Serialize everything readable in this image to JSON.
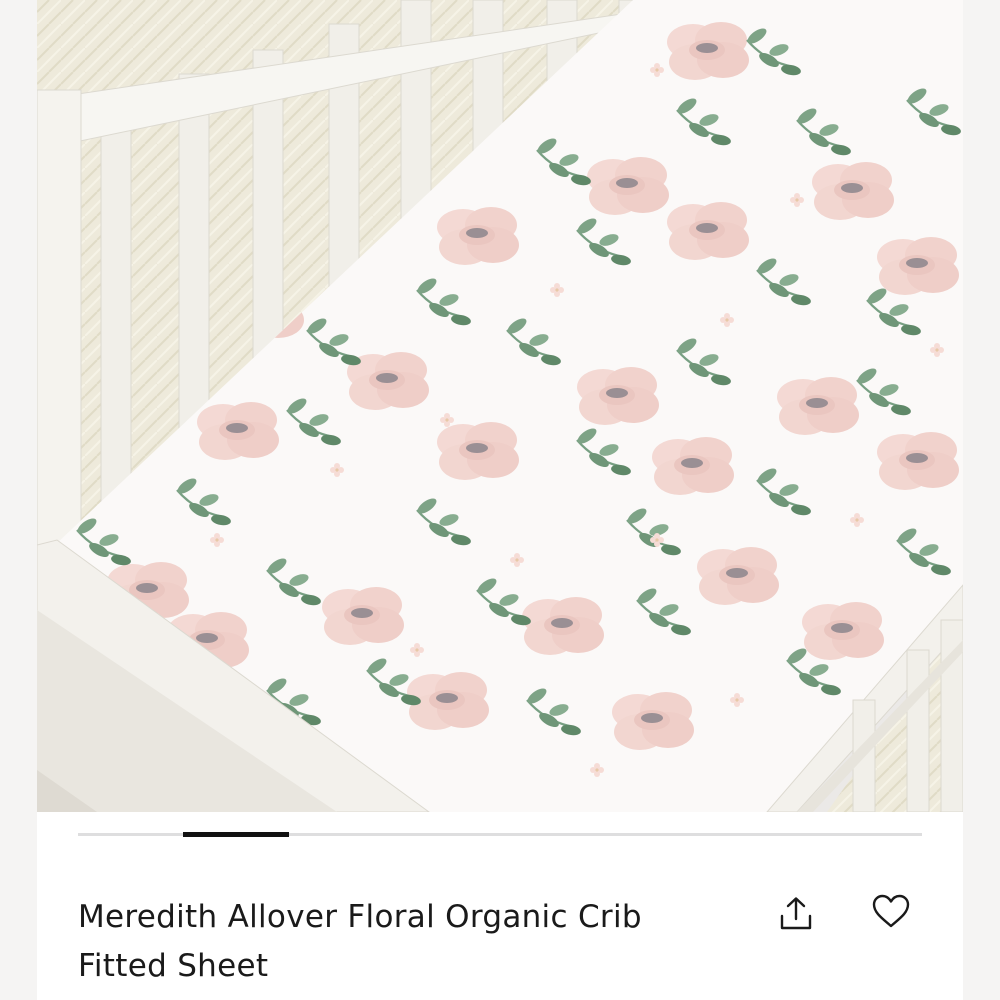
{
  "product": {
    "title": "Meredith Allover Floral Organic Crib Fitted Sheet",
    "image_alt": "Crib fitted sheet with pink watercolor flowers and sage green leaves"
  },
  "carousel": {
    "slide_count": 4,
    "active_slide": 2,
    "indicator_color": "#111111"
  },
  "actions": {
    "share_icon": "share-upload-icon",
    "favorite_icon": "heart-outline-icon"
  },
  "colors": {
    "sheet": "#fbf9f8",
    "flower": "#f0cfc9",
    "leaf": "#7ea386",
    "crib": "#f2f0ea"
  }
}
